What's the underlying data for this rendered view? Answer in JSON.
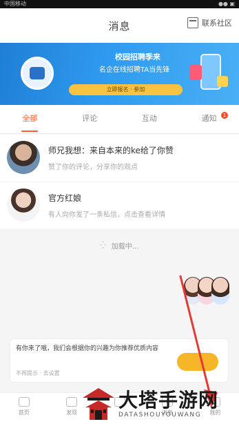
{
  "status_bar": {
    "left": "中国移动",
    "right": "●● ▣"
  },
  "header": {
    "title": "消息",
    "action_label": "联系社区"
  },
  "banner": {
    "headline": "校园招聘季来",
    "subline": "名企在线招聘TA当先锋",
    "cta": "立即报名 · 参加"
  },
  "tabs": [
    {
      "label": "全部",
      "active": true
    },
    {
      "label": "评论",
      "active": false
    },
    {
      "label": "互动",
      "active": false
    },
    {
      "label": "通知",
      "active": false,
      "badge": "1"
    }
  ],
  "messages": [
    {
      "title": "师兄我想：来自本来的ke给了你赞",
      "preview": "赞了你的评论，分享你的观点"
    },
    {
      "title": "官方红娘",
      "preview": "有人向你发了一条私信，点击查看详情"
    }
  ],
  "loading_text": "加载中...",
  "notice": {
    "text": "有你来了哦，我们会根据你的兴趣为你推荐优质内容",
    "sub": "不再提示  ·  去设置",
    "button": ""
  },
  "bottom_nav": [
    "首页",
    "发现",
    "",
    "消息",
    "我的"
  ],
  "watermark": {
    "title": "大塔手游网",
    "subtitle": "DATASHOUYOUWANG"
  },
  "colors": {
    "accent": "#ff5a2c",
    "banner": "#2f9bf0",
    "annotation_arrow": "#e53935"
  }
}
